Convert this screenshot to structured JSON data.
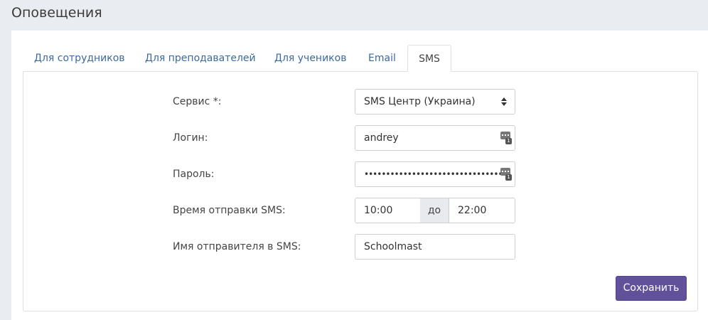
{
  "page": {
    "title": "Оповещения"
  },
  "tabs": [
    {
      "label": "Для сотрудников",
      "active": false
    },
    {
      "label": "Для преподавателей",
      "active": false
    },
    {
      "label": "Для учеников",
      "active": false
    },
    {
      "label": "Email",
      "active": false
    },
    {
      "label": "SMS",
      "active": true
    }
  ],
  "form": {
    "service": {
      "label": "Сервис *:",
      "value": "SMS Центр (Украина)"
    },
    "login": {
      "label": "Логин:",
      "value": "andrey"
    },
    "password": {
      "label": "Пароль:",
      "value": "••••••••••••••••••••••••••••••••••••••••••••••••"
    },
    "send_time": {
      "label": "Время отправки SMS:",
      "from": "10:00",
      "separator": "до",
      "to": "22:00"
    },
    "sender_name": {
      "label": "Имя отправителя в SMS:",
      "value": "Schoolmast"
    }
  },
  "save_button": "Сохранить",
  "icons": {
    "select": "chevron-up-down-icon",
    "password_manager": "password-manager-icon"
  },
  "colors": {
    "accent": "#61509a",
    "link": "#3b6aa0",
    "background": "#e9ecf0"
  }
}
